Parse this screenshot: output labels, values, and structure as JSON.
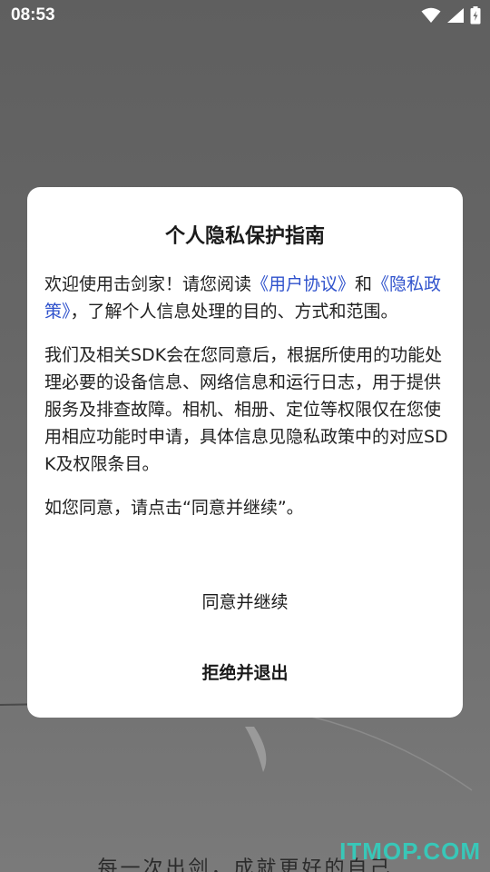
{
  "status_bar": {
    "time": "08:53",
    "icons": [
      "wifi-icon",
      "cellular-signal-icon",
      "battery-charging-icon"
    ]
  },
  "background": {
    "slogan": "每一次出剑，成就更好的自己",
    "watermark": "ITMOP.COM"
  },
  "dialog": {
    "title": "个人隐私保护指南",
    "paragraph1": {
      "text_before": "欢迎使用击剑家！请您阅读",
      "link_user_agreement": "《用户协议》",
      "text_and": "和",
      "link_privacy_policy": "《隐私政策》",
      "text_after": "，了解个人信息处理的目的、方式和范围。"
    },
    "paragraph2": "我们及相关SDK会在您同意后，根据所使用的功能处理必要的设备信息、网络信息和运行日志，用于提供服务及排查故障。相机、相册、定位等权限仅在您使用相应功能时申请，具体信息见隐私政策中的对应SDK及权限条目。",
    "paragraph3": "如您同意，请点击“同意并继续”。",
    "agree_label": "同意并继续",
    "reject_label": "拒绝并退出"
  },
  "colors": {
    "link": "#2f52cc",
    "overlay": "#6f6f6f",
    "watermark": "#38c7b8"
  }
}
